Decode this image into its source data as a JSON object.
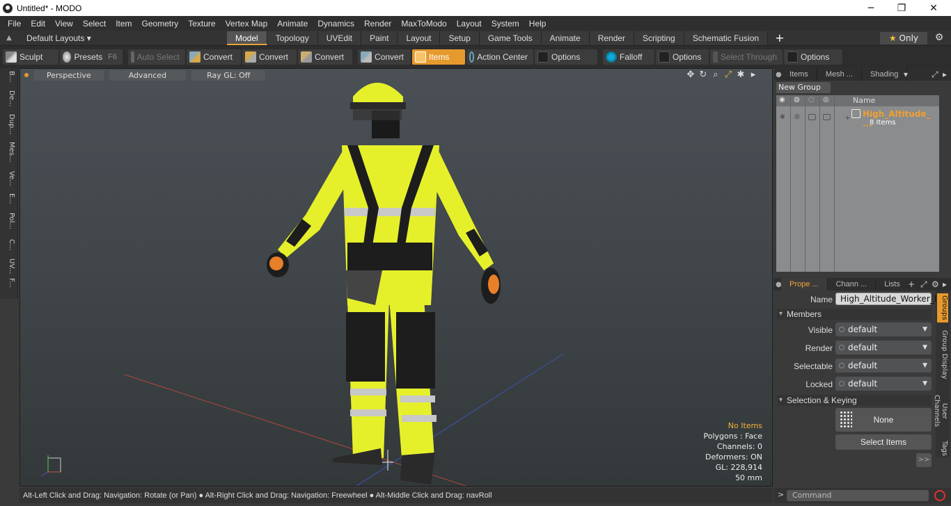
{
  "window": {
    "title": "Untitled* - MODO",
    "minimize": "─",
    "maximize": "❐",
    "close": "✕"
  },
  "menu": [
    "File",
    "Edit",
    "View",
    "Select",
    "Item",
    "Geometry",
    "Texture",
    "Vertex Map",
    "Animate",
    "Dynamics",
    "Render",
    "MaxToModo",
    "Layout",
    "System",
    "Help"
  ],
  "layoutbar": {
    "layouts_label": "Default Layouts ▾",
    "tabs": [
      "Model",
      "Topology",
      "UVEdit",
      "Paint",
      "Layout",
      "Setup",
      "Game Tools",
      "Animate",
      "Render",
      "Scripting",
      "Schematic Fusion"
    ],
    "active_tab": "Model",
    "only_label": "Only"
  },
  "toolbar": {
    "sculpt": "Sculpt",
    "presets": "Presets",
    "presets_key": "F6",
    "auto_select": "Auto Select",
    "convert": "Convert",
    "items": "Items",
    "action_center": "Action Center",
    "options": "Options",
    "falloff": "Falloff",
    "select_through": "Select Through"
  },
  "lefttabs": [
    "B...",
    "De...",
    "Dup...",
    "Mes...",
    "Ve...",
    "E...",
    "Pol...",
    "C...",
    "UV...",
    "F..."
  ],
  "viewport": {
    "perspective": "Perspective",
    "advanced": "Advanced",
    "raygl": "Ray GL: Off",
    "stats": {
      "items": "No Items",
      "polygons": "Polygons : Face",
      "channels": "Channels: 0",
      "deformers": "Deformers: ON",
      "gl": "GL: 228,914",
      "focal": "50 mm"
    }
  },
  "statusbar": "Alt-Left Click and Drag: Navigation: Rotate (or Pan) ● Alt-Right Click and Drag: Navigation: Freewheel ● Alt-Middle Click and Drag: navRoll",
  "itemspanel": {
    "tabs": [
      "Items",
      "Mesh ...",
      "Shading"
    ],
    "new_group": "New Group",
    "col_name": "Name",
    "item_name": "High_Altitude_ ...",
    "item_count": "8 Items"
  },
  "propspanel": {
    "tabs": [
      "Prope ...",
      "Chann ...",
      "Lists"
    ],
    "name_label": "Name",
    "name_value": "High_Altitude_Worker_Ful",
    "members_section": "Members",
    "visible_label": "Visible",
    "render_label": "Render",
    "selectable_label": "Selectable",
    "locked_label": "Locked",
    "default_value": "default",
    "keying_section": "Selection & Keying",
    "none_label": "None",
    "select_items": "Select Items",
    "more": ">>",
    "side_tabs": [
      "Groups",
      "Group Display",
      "User Channels",
      "Tags"
    ]
  },
  "command": {
    "prompt": ">",
    "placeholder": "Command"
  },
  "colors": {
    "accent": "#e69a2e",
    "suit_yellow": "#e6f02a",
    "suit_black": "#1d1d1d",
    "reflective": "#c8c8c8"
  }
}
